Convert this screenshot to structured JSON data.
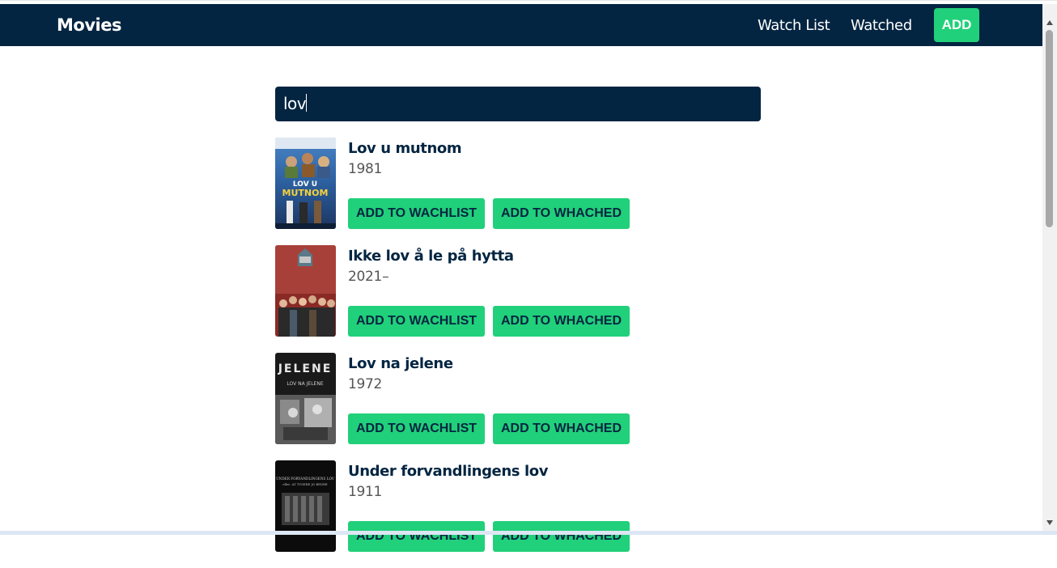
{
  "navbar": {
    "brand": "Movies",
    "links": [
      "Watch List",
      "Watched"
    ],
    "add_label": "ADD",
    "bg": "#032541",
    "accent": "#21d07a"
  },
  "search": {
    "value": "lov"
  },
  "results": [
    {
      "title": "Lov u mutnom",
      "year": "1981",
      "watchlist_label": "ADD TO WACHLIST",
      "watched_label": "ADD TO WHACHED",
      "poster_text": "LOV U MUTNOM"
    },
    {
      "title": "Ikke lov å le på hytta",
      "year": "2021–",
      "watchlist_label": "ADD TO WACHLIST",
      "watched_label": "ADD TO WHACHED"
    },
    {
      "title": "Lov na jelene",
      "year": "1972",
      "watchlist_label": "ADD TO WACHLIST",
      "watched_label": "ADD TO WHACHED",
      "poster_text": "JELENE",
      "poster_subtext": "LOV NA JELENE"
    },
    {
      "title": "Under forvandlingens lov",
      "year": "1911",
      "watchlist_label": "ADD TO WACHLIST",
      "watched_label": "ADD TO WHACHED",
      "poster_text": "UNDER FORVANDLINGENS LOV",
      "poster_subtext": "eller: AT TYGERE JO BEDRE"
    }
  ]
}
